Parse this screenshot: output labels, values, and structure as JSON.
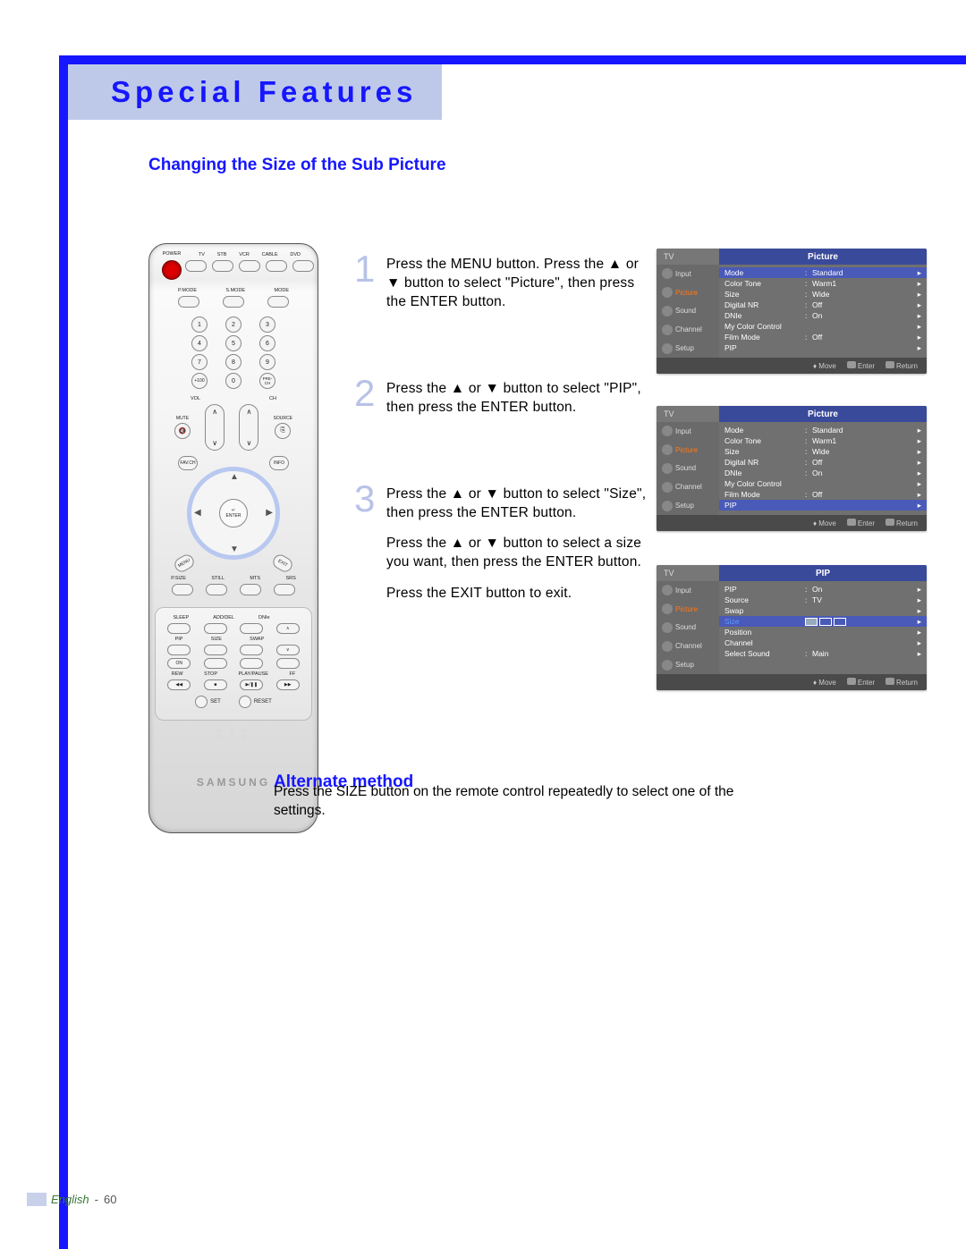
{
  "header": {
    "title": "Special Features"
  },
  "subheading": "Changing the Size of the Sub Picture",
  "steps": [
    {
      "num": "1",
      "text": "Press the MENU button. Press the ▲ or ▼ button to select \"Picture\", then press the ENTER button."
    },
    {
      "num": "2",
      "text": "Press the ▲ or ▼ button to select \"PIP\", then press the ENTER button."
    },
    {
      "num": "3",
      "para1": "Press the ▲ or ▼ button to select \"Size\", then press the ENTER button.",
      "para2": "Press the ▲ or ▼ button to select a size you want, then press the ENTER button.",
      "para3": "Press the EXIT button to exit."
    }
  ],
  "alternate": {
    "heading": "Alternate method",
    "text": "Press the SIZE button on the remote control repeatedly to select one of the settings."
  },
  "osd_side_items": [
    "Input",
    "Picture",
    "Sound",
    "Channel",
    "Setup"
  ],
  "osd_footer": {
    "move": "Move",
    "enter": "Enter",
    "return": "Return"
  },
  "osd1": {
    "tv": "TV",
    "title": "Picture",
    "rows": [
      {
        "k": "Mode",
        "v": "Standard"
      },
      {
        "k": "Color Tone",
        "v": "Warm1"
      },
      {
        "k": "Size",
        "v": "Wide"
      },
      {
        "k": "Digital NR",
        "v": "Off"
      },
      {
        "k": "DNIe",
        "v": "On"
      },
      {
        "k": "My Color Control",
        "v": ""
      },
      {
        "k": "Film Mode",
        "v": "Off"
      },
      {
        "k": "PIP",
        "v": ""
      }
    ],
    "highlight": 0
  },
  "osd2": {
    "tv": "TV",
    "title": "Picture",
    "rows": [
      {
        "k": "Mode",
        "v": "Standard"
      },
      {
        "k": "Color Tone",
        "v": "Warm1"
      },
      {
        "k": "Size",
        "v": "Wide"
      },
      {
        "k": "Digital NR",
        "v": "Off"
      },
      {
        "k": "DNIe",
        "v": "On"
      },
      {
        "k": "My Color Control",
        "v": ""
      },
      {
        "k": "Film Mode",
        "v": "Off"
      },
      {
        "k": "PIP",
        "v": ""
      }
    ],
    "highlight": 7
  },
  "osd3": {
    "tv": "TV",
    "title": "PIP",
    "rows": [
      {
        "k": "PIP",
        "v": "On"
      },
      {
        "k": "Source",
        "v": "TV"
      },
      {
        "k": "Swap",
        "v": ""
      },
      {
        "k": "Size",
        "v": ""
      },
      {
        "k": "Position",
        "v": ""
      },
      {
        "k": "Channel",
        "v": ""
      },
      {
        "k": "Select Sound",
        "v": "Main"
      }
    ],
    "highlight": 3
  },
  "remote": {
    "top_labels": [
      "TV",
      "STB",
      "VCR",
      "CABLE",
      "DVD"
    ],
    "power": "POWER",
    "row_modes_labels": [
      "P.MODE",
      "S.MODE",
      "MODE"
    ],
    "numpad": [
      "1",
      "2",
      "3",
      "4",
      "5",
      "6",
      "7",
      "8",
      "9",
      "+100",
      "0",
      "PRE-CH"
    ],
    "vol": "VOL",
    "ch": "CH",
    "mute": "MUTE",
    "source": "SOURCE",
    "corner": {
      "tl": "FAV.CH",
      "tr": "INFO",
      "bl": "MENU",
      "br": "EXIT"
    },
    "dpad_center_icon": "↵",
    "dpad_center_label": "ENTER",
    "row_feat_labels": [
      "P.SIZE",
      "STILL",
      "MTS",
      "SRS"
    ],
    "lower_row1": [
      "SLEEP",
      "ADD/DEL",
      "DNIe",
      ""
    ],
    "lower_row2": [
      "PIP",
      "SIZE",
      "SWAP",
      ""
    ],
    "lower_row3": [
      "ON",
      "",
      "",
      ""
    ],
    "lower_row4_labels": [
      "REW",
      "STOP",
      "PLAY/PAUSE",
      "FF"
    ],
    "lower_row4_icons": [
      "◀◀",
      "■",
      "▶/❚❚",
      "▶▶"
    ],
    "set_reset": [
      "SET",
      "RESET"
    ],
    "brand": "SAMSUNG"
  },
  "footer": {
    "lang": "English",
    "page": "60"
  }
}
